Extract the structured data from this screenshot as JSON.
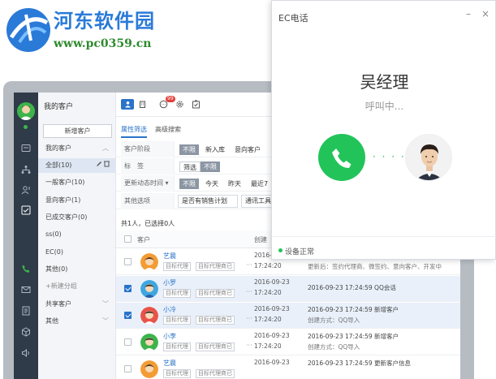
{
  "watermark": {
    "title": "河东软件园",
    "url": "www.pc0359.cn"
  },
  "app": {
    "nav": {
      "title": "我的客户",
      "add_button": "新增客户",
      "items": [
        {
          "label": "我的客户",
          "chevron": "︿"
        },
        {
          "label": "全部(10)"
        },
        {
          "label": "一般客户(10)"
        },
        {
          "label": "意向客户(1)"
        },
        {
          "label": "已成交客户(0)"
        },
        {
          "label": "ss(0)"
        },
        {
          "label": "EC(0)"
        },
        {
          "label": "其他(0)"
        },
        {
          "label": "+新建分组"
        },
        {
          "label": "共享客户",
          "chevron": "﹀"
        },
        {
          "label": "其他",
          "chevron": "﹀"
        }
      ]
    },
    "toolbar": {
      "badge": "99"
    },
    "tabs": [
      {
        "label": "属性筛选"
      },
      {
        "label": "高级搜索"
      }
    ],
    "filters": {
      "stage": {
        "label": "客户阶段",
        "options": [
          "不限",
          "新入库",
          "意向客户"
        ]
      },
      "tag": {
        "label": "标　签",
        "options": [
          "筛选",
          "不限"
        ]
      },
      "time": {
        "label": "更新动态时间",
        "options": [
          "不限",
          "今天",
          "昨天",
          "最近7"
        ]
      },
      "other": {
        "label": "其他选项",
        "dropdowns": [
          "是否有销售计划",
          "通讯工具"
        ]
      }
    },
    "count_text": "共1人，已选择0人",
    "table": {
      "col_customer": "客户",
      "col_created": "创建"
    },
    "rows": [
      {
        "name": "艺晨",
        "tags": [
          "目标代理",
          "目标代理商已"
        ],
        "date1": "2016-09",
        "date2": "17:24:20",
        "act1": "",
        "act2": "更新后：签约代理商、微签约、意向客户、开发中",
        "checked": false
      },
      {
        "name": "小罗",
        "tags": [
          "目标代理",
          "目标代理商已"
        ],
        "date1": "2016-09-23",
        "date2": "17:24:20",
        "act1": "2016-09-23 17:24:59  QQ会话",
        "act2": "",
        "checked": true
      },
      {
        "name": "小冷",
        "tags": [
          "目标代理",
          "目标代理商已"
        ],
        "date1": "2016-09-23",
        "date2": "17:24:20",
        "act1": "2016-09-23 17:24:59  新增客户",
        "act2": "创建方式：QQ导入",
        "checked": true
      },
      {
        "name": "小李",
        "tags": [
          "目标代理",
          "目标代理商已"
        ],
        "date1": "2016-09-23",
        "date2": "17:24:20",
        "act1": "2016-09-23 17:24:59  新增客户",
        "act2": "创建方式：QQ导入",
        "checked": false
      },
      {
        "name": "艺晨",
        "tags": [
          "目标代理",
          "目标代理商已"
        ],
        "date1": "2016-09-23",
        "date2": "",
        "act1": "2016-09-23 17:24:59  更新客户信息",
        "act2": "",
        "checked": false
      }
    ]
  },
  "call_popup": {
    "title": "EC电话",
    "minimize": "–",
    "close": "×",
    "contact_name": "吴经理",
    "status": "呼叫中...",
    "dots": "· · · · ·",
    "footer": "设备正常",
    "colors": {
      "accent": "#22c45a"
    }
  }
}
